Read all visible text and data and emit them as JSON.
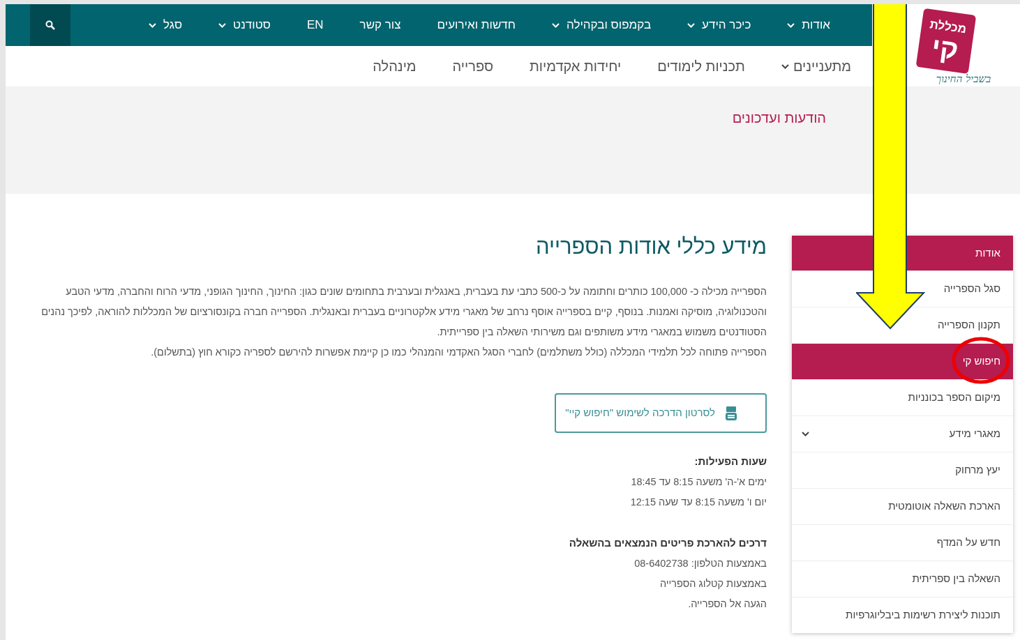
{
  "top_nav": {
    "items": [
      {
        "label": "אודות",
        "has_menu": true
      },
      {
        "label": "כיכר הידע",
        "has_menu": true
      },
      {
        "label": "בקמפוס ובקהילה",
        "has_menu": true
      },
      {
        "label": "חדשות ואירועים",
        "has_menu": false
      },
      {
        "label": "צור קשר",
        "has_menu": false
      },
      {
        "label": "EN",
        "has_menu": false
      },
      {
        "label": "סטודנט",
        "has_menu": true
      },
      {
        "label": "סגל",
        "has_menu": true
      }
    ]
  },
  "logo": {
    "title": "מכללת",
    "mark": "קי",
    "tagline": "בשביל החינוך"
  },
  "sub_nav": {
    "items": [
      {
        "label": "מתעניינים",
        "has_menu": true
      },
      {
        "label": "תכניות לימודים",
        "has_menu": false
      },
      {
        "label": "יחידות אקדמיות",
        "has_menu": false
      },
      {
        "label": "ספרייה",
        "has_menu": false
      },
      {
        "label": "מינהלה",
        "has_menu": false
      }
    ]
  },
  "banner": {
    "title": "הודעות ועדכונים"
  },
  "sidebar": {
    "header": "אודות",
    "items": [
      {
        "label": "סגל הספרייה",
        "selected": false,
        "has_menu": false
      },
      {
        "label": "תקנון הספרייה",
        "selected": false,
        "has_menu": false
      },
      {
        "label": "חיפוש קי",
        "selected": true,
        "has_menu": false
      },
      {
        "label": "מיקום הספר בכונניות",
        "selected": false,
        "has_menu": false
      },
      {
        "label": "מאגרי מידע",
        "selected": false,
        "has_menu": true
      },
      {
        "label": "יעץ מרחוק",
        "selected": false,
        "has_menu": false
      },
      {
        "label": "הארכת השאלה אוטומטית",
        "selected": false,
        "has_menu": false
      },
      {
        "label": "חדש על המדף",
        "selected": false,
        "has_menu": false
      },
      {
        "label": "השאלה בין ספריתית",
        "selected": false,
        "has_menu": false
      },
      {
        "label": "תוכנות ליצירת רשימות ביבליוגרפיות",
        "selected": false,
        "has_menu": false
      }
    ]
  },
  "article": {
    "title": "מידע כללי אודות הספרייה",
    "paragraphs": [
      "הספרייה מכילה כ- 100,000 כותרים וחתומה על כ-500 כתבי עת בעברית, באנגלית ובערבית בתחומים שונים כגון: החינוך, החינוך הגופני, מדעי הרוח והחברה, מדעי הטבע והטכנולוגיה, מוסיקה ואמנות. בנוסף, קיים בספרייה אוסף נרחב של מאגרי מידע אלקטרוניים בעברית ובאנגלית. הספרייה חברה בקונסורציום של המכללות להוראה, לפיכך נהנים הסטודנטים משמוש במאגרי מידע משותפים וגם משירותי השאלה בין ספרייתית.",
      "הספרייה פתוחה לכל תלמידי המכללה (כולל משתלמים) לחברי הסגל האקדמי והמנהלי כמו כן קיימת אפשרות להירשם לספריה כקורא חוץ (בתשלום)."
    ],
    "video_button": "לסרטון הדרכה לשימוש \"חיפוש קיי\"",
    "sections": [
      {
        "heading": "שעות הפעילות:",
        "lines": [
          "ימים א'-ה' משעה 8:15 עד 18:45",
          "יום ו' משעה 8:15 עד שעה 12:15"
        ]
      },
      {
        "heading": "דרכים להארכת פריטים הנמצאים בהשאלה",
        "lines": [
          "באמצעות הטלפון: 08-6402738",
          "באמצעות קטלוג הספרייה",
          "הגעה אל הספרייה."
        ]
      }
    ]
  }
}
